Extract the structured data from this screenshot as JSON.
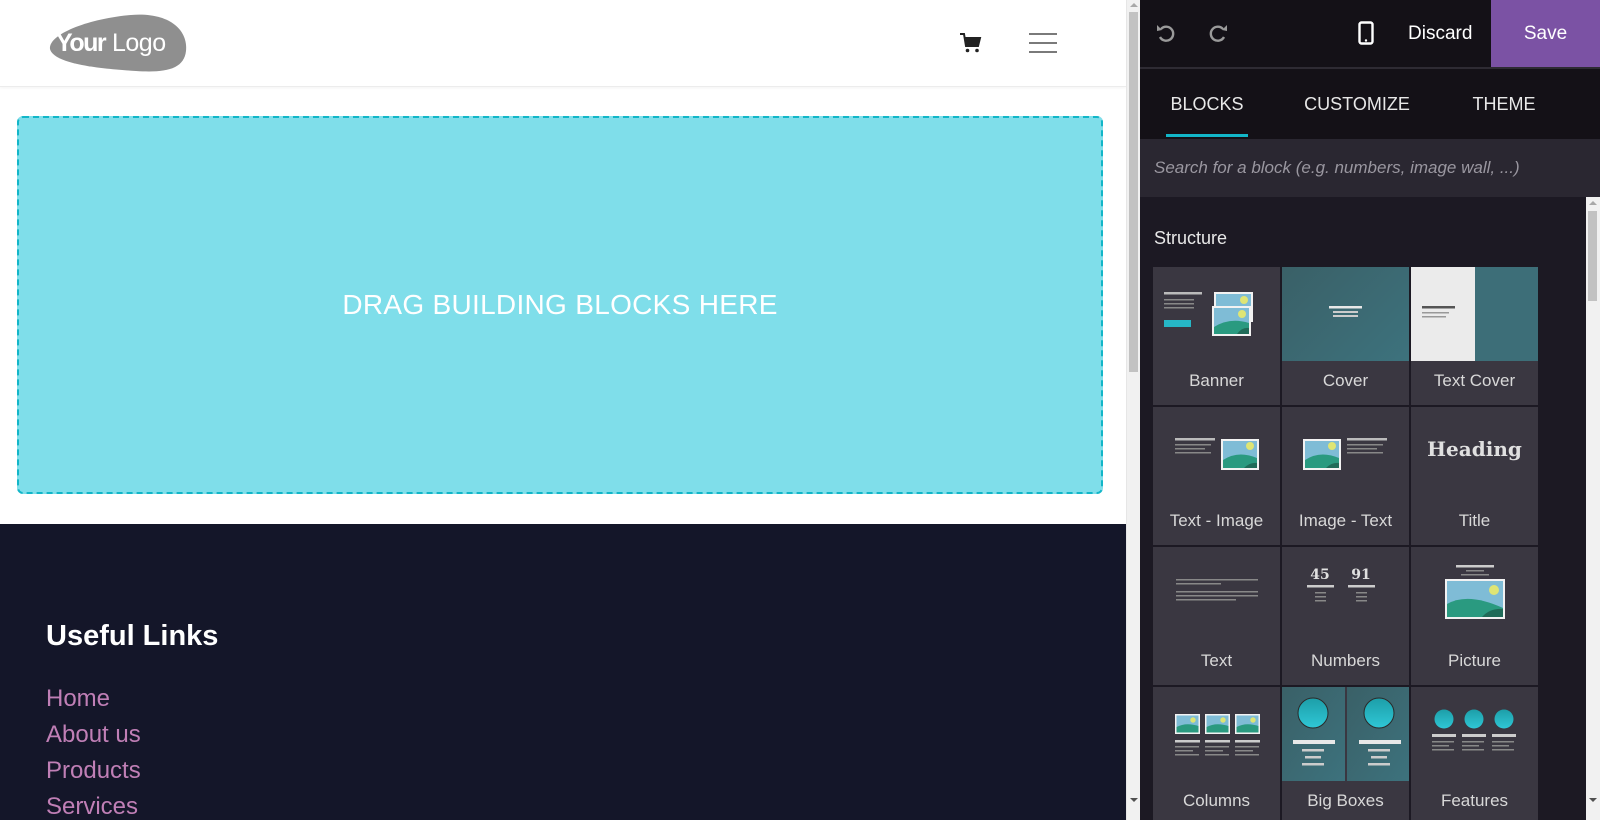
{
  "site": {
    "logo": {
      "text_bold": "Your",
      "text_light": "Logo"
    },
    "header_icons": {
      "cart": "cart-icon",
      "menu": "hamburger-menu-icon"
    },
    "dropzone": {
      "label": "DRAG BUILDING BLOCKS HERE"
    },
    "footer": {
      "title": "Useful Links",
      "links": [
        "Home",
        "About us",
        "Products",
        "Services"
      ]
    }
  },
  "editor": {
    "toolbar": {
      "undo_icon": "undo-icon",
      "redo_icon": "redo-icon",
      "mobile_icon": "mobile-preview-icon",
      "discard_label": "Discard",
      "save_label": "Save"
    },
    "tabs": [
      {
        "label": "BLOCKS",
        "active": true
      },
      {
        "label": "CUSTOMIZE",
        "active": false
      },
      {
        "label": "THEME",
        "active": false
      }
    ],
    "search": {
      "placeholder": "Search for a block (e.g. numbers, image wall, ...)",
      "value": ""
    },
    "section": {
      "title": "Structure",
      "blocks": [
        {
          "label": "Banner"
        },
        {
          "label": "Cover"
        },
        {
          "label": "Text Cover"
        },
        {
          "label": "Text - Image"
        },
        {
          "label": "Image - Text"
        },
        {
          "label": "Title",
          "thumb_text": "Heading"
        },
        {
          "label": "Text"
        },
        {
          "label": "Numbers",
          "thumb_numbers": [
            "45",
            "91"
          ]
        },
        {
          "label": "Picture"
        },
        {
          "label": "Columns"
        },
        {
          "label": "Big Boxes"
        },
        {
          "label": "Features"
        }
      ]
    }
  },
  "colors": {
    "accent": "#12b6c8",
    "save": "#7b52a4",
    "dropzone_bg": "#7fdeea",
    "footer_bg": "#141629",
    "footer_link": "#c07fb6",
    "editor_bg": "#1c1923",
    "teal_thumb": "#3d6e78"
  }
}
